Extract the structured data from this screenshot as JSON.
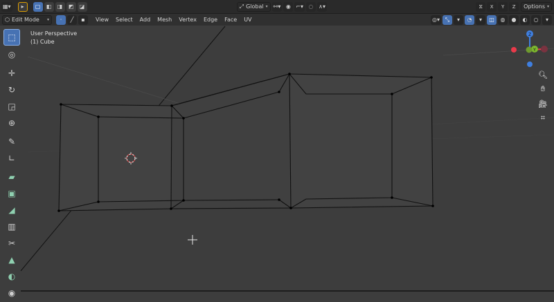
{
  "topbar": {
    "transform_orientation": "Global",
    "axis_x": "X",
    "axis_y": "Y",
    "axis_z": "Z",
    "options": "Options"
  },
  "header": {
    "mode": "Edit Mode",
    "menus": [
      "View",
      "Select",
      "Add",
      "Mesh",
      "Vertex",
      "Edge",
      "Face",
      "UV"
    ]
  },
  "viewport": {
    "view_name": "User Perspective",
    "object_name": "(1) Cube"
  },
  "toolbar": {
    "tools": [
      {
        "name": "select-box",
        "glyph": "⬚"
      },
      {
        "name": "cursor",
        "glyph": "◎"
      },
      {
        "name": "move",
        "glyph": "✛"
      },
      {
        "name": "rotate",
        "glyph": "↻"
      },
      {
        "name": "scale",
        "glyph": "◲"
      },
      {
        "name": "transform",
        "glyph": "⊕"
      },
      {
        "name": "annotate",
        "glyph": "✎"
      },
      {
        "name": "measure",
        "glyph": "📐"
      },
      {
        "name": "extrude",
        "glyph": "▰"
      },
      {
        "name": "inset",
        "glyph": "▣"
      },
      {
        "name": "bevel",
        "glyph": "◢"
      },
      {
        "name": "loop-cut",
        "glyph": "▥"
      },
      {
        "name": "knife",
        "glyph": "✂"
      },
      {
        "name": "poly-build",
        "glyph": "▲"
      },
      {
        "name": "spin",
        "glyph": "◐"
      },
      {
        "name": "smooth",
        "glyph": "◉"
      }
    ]
  },
  "gizmo": {
    "x_color": "#ea3a4a",
    "y_color": "#7db72e",
    "z_color": "#3f7fe0",
    "label_y": "Y",
    "label_z": "Z"
  },
  "colors": {
    "viewport_bg": "#3d3d3d",
    "accent": "#4772b3",
    "wire": "#111111"
  }
}
